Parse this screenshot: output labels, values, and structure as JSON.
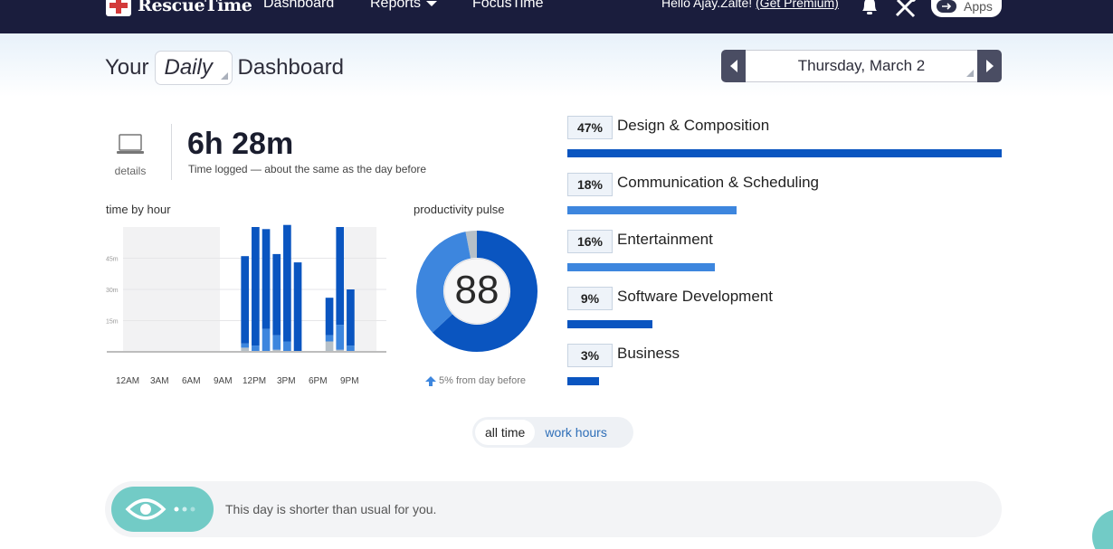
{
  "nav": {
    "brand": "RescueTime",
    "links": [
      {
        "label": "Dashboard"
      },
      {
        "label": "Reports"
      },
      {
        "label": "FocusTime"
      }
    ],
    "greeting": "Hello Ajay.Zalte!",
    "premium_link": "(Get Premium)",
    "apps_label": "Apps"
  },
  "header": {
    "title_prefix": "Your",
    "period": "Daily",
    "title_suffix": "Dashboard",
    "date": "Thursday, March 2"
  },
  "summary": {
    "details_label": "details",
    "time_logged": "6h 28m",
    "subtitle": "Time logged — about the same as the day before"
  },
  "time_by_hour": {
    "label": "time by hour",
    "y_ticks": [
      "45m",
      "30m",
      "15m"
    ],
    "x_labels": [
      "12AM",
      "3AM",
      "6AM",
      "9AM",
      "12PM",
      "3PM",
      "6PM",
      "9PM"
    ]
  },
  "productivity_pulse": {
    "label": "productivity pulse",
    "score": "88",
    "change_text": "5% from day before",
    "colors": {
      "very_productive": "#0a55c0",
      "productive": "#3d86de",
      "neutral": "#b6c0c8"
    }
  },
  "chart_data": {
    "type": "bar",
    "x": [
      0,
      1,
      2,
      3,
      4,
      5,
      6,
      7,
      8,
      9,
      10,
      11,
      12,
      13,
      14,
      15,
      16,
      17,
      18,
      19,
      20,
      21,
      22,
      23
    ],
    "series": [
      {
        "key": "productive",
        "values": [
          0,
          0,
          0,
          0,
          0,
          0,
          0,
          0,
          0,
          0,
          0,
          2,
          3,
          11,
          7,
          5,
          0,
          0,
          0,
          3,
          12,
          3,
          0,
          0
        ]
      },
      {
        "key": "very_productive",
        "values": [
          0,
          0,
          0,
          0,
          0,
          0,
          0,
          0,
          0,
          0,
          0,
          42,
          57,
          48,
          39,
          56,
          43,
          0,
          0,
          18,
          47,
          27,
          0,
          0
        ]
      },
      {
        "key": "neutral",
        "values": [
          0,
          0,
          0,
          0,
          0,
          0,
          0,
          0,
          0,
          0,
          0,
          2,
          0,
          0,
          1,
          0,
          0,
          0,
          0,
          5,
          1,
          0,
          0,
          0
        ]
      }
    ],
    "ylim": [
      0,
      60
    ],
    "y_ticks": [
      15,
      30,
      45
    ],
    "work_hours_shaded": [
      9,
      20
    ],
    "colors": {
      "productive": "#3d86de",
      "very_productive": "#0a55c0",
      "neutral": "#b6c0c8"
    },
    "pulse_segments": {
      "very_productive": 0.63,
      "productive": 0.34,
      "neutral": 0.03
    }
  },
  "categories": [
    {
      "pct": "47%",
      "name": "Design & Composition",
      "fraction": 1.0,
      "color": "#0a55c0"
    },
    {
      "pct": "18%",
      "name": "Communication & Scheduling",
      "fraction": 0.39,
      "color": "#3d86de"
    },
    {
      "pct": "16%",
      "name": "Entertainment",
      "fraction": 0.34,
      "color": "#3d86de"
    },
    {
      "pct": "9%",
      "name": "Software Development",
      "fraction": 0.195,
      "color": "#0a55c0"
    },
    {
      "pct": "3%",
      "name": "Business",
      "fraction": 0.072,
      "color": "#0a55c0"
    }
  ],
  "toggle": {
    "all_time": "all time",
    "work_hours": "work hours"
  },
  "insight": {
    "text": "This day is shorter than usual for you."
  }
}
